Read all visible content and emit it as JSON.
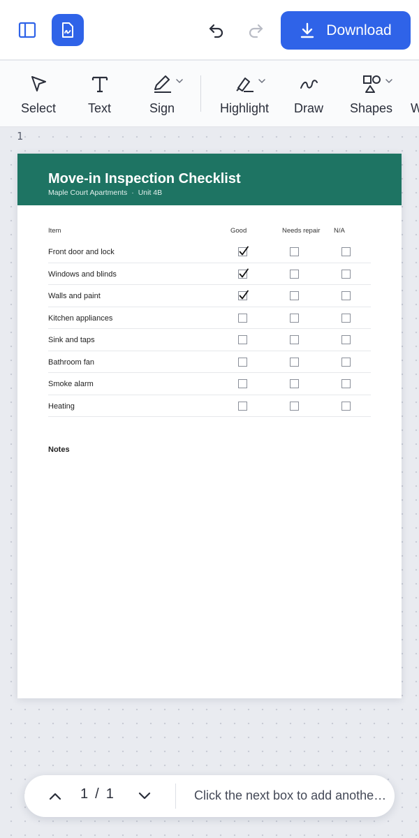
{
  "topbar": {
    "download_label": "Download"
  },
  "toolbar": {
    "tools": [
      {
        "label": "Select"
      },
      {
        "label": "Text"
      },
      {
        "label": "Sign"
      },
      {
        "label": "Highlight"
      },
      {
        "label": "Draw"
      },
      {
        "label": "Shapes"
      },
      {
        "label": "W"
      }
    ]
  },
  "workspace": {
    "page_number": "1"
  },
  "document": {
    "title": "Move-in Inspection Checklist",
    "subtitle_property": "Maple Court Apartments",
    "subtitle_separator": "·",
    "subtitle_unit": "Unit 4B",
    "columns": {
      "item": "Item",
      "good": "Good",
      "needs_repair": "Needs repair",
      "na": "N/A"
    },
    "rows": [
      {
        "item": "Front door and lock",
        "good": true,
        "needs_repair": false,
        "na": false
      },
      {
        "item": "Windows and blinds",
        "good": true,
        "needs_repair": false,
        "na": false
      },
      {
        "item": "Walls and paint",
        "good": true,
        "needs_repair": false,
        "na": false
      },
      {
        "item": "Kitchen appliances",
        "good": false,
        "needs_repair": false,
        "na": false
      },
      {
        "item": "Sink and taps",
        "good": false,
        "needs_repair": false,
        "na": false
      },
      {
        "item": "Bathroom fan",
        "good": false,
        "needs_repair": false,
        "na": false
      },
      {
        "item": "Smoke alarm",
        "good": false,
        "needs_repair": false,
        "na": false
      },
      {
        "item": "Heating",
        "good": false,
        "needs_repair": false,
        "na": false
      }
    ],
    "notes_label": "Notes"
  },
  "pager": {
    "current_page": "1",
    "separator": "/",
    "total_pages": "1",
    "hint": "Click the next box to add another checkmark"
  },
  "colors": {
    "accent": "#2f63e8",
    "header_green": "#1e7463"
  },
  "icons": {
    "sidebar_toggle": "sidebar-panel-icon",
    "document": "document-signature-icon",
    "undo": "undo-icon",
    "redo": "redo-icon",
    "download": "download-icon",
    "select": "cursor-arrow-icon",
    "text": "text-t-icon",
    "sign": "pen-icon",
    "highlight": "highlighter-icon",
    "draw": "squiggle-icon",
    "shapes": "shapes-icon",
    "pager_prev": "chevron-up-icon",
    "pager_next": "chevron-down-icon"
  }
}
